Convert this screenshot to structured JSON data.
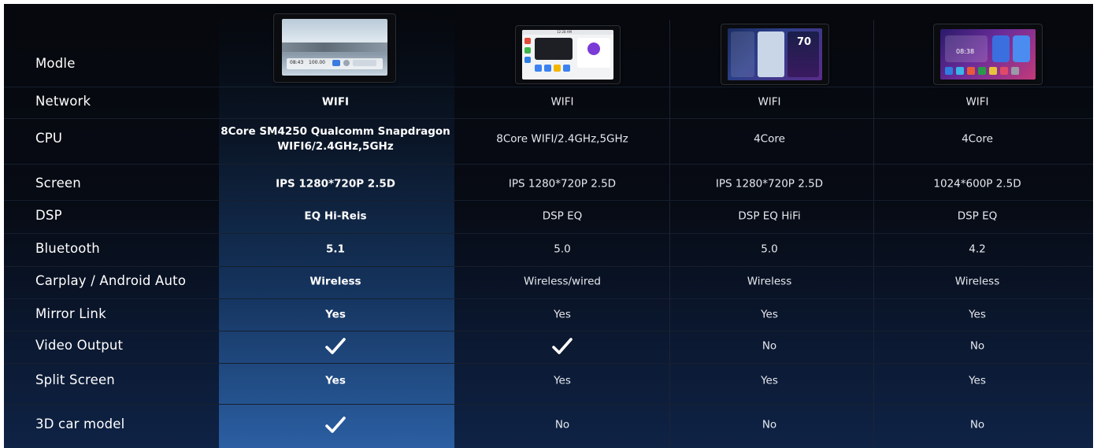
{
  "rows": [
    {
      "label": "Modle",
      "values": [
        "",
        "",
        "",
        ""
      ]
    },
    {
      "label": "Network",
      "values": [
        "WIFI",
        "WIFI",
        "WIFI",
        "WIFI"
      ]
    },
    {
      "label": "CPU",
      "values": [
        "8Core SM4250 Qualcomm Snapdragon\nWIFI6/2.4GHz,5GHz",
        "8Core WIFI/2.4GHz,5GHz",
        "4Core",
        "4Core"
      ]
    },
    {
      "label": "Screen",
      "values": [
        "IPS 1280*720P 2.5D",
        "IPS 1280*720P 2.5D",
        "IPS 1280*720P 2.5D",
        "1024*600P 2.5D"
      ]
    },
    {
      "label": "DSP",
      "values": [
        "EQ Hi-Reis",
        "DSP EQ",
        "DSP EQ HiFi",
        "DSP EQ"
      ]
    },
    {
      "label": "Bluetooth",
      "values": [
        "5.1",
        "5.0",
        "5.0",
        "4.2"
      ]
    },
    {
      "label": "Carplay / Android Auto",
      "values": [
        "Wireless",
        "Wireless/wired",
        "Wireless",
        "Wireless"
      ]
    },
    {
      "label": "Mirror Link",
      "values": [
        "Yes",
        "Yes",
        "Yes",
        "Yes"
      ]
    },
    {
      "label": "Video Output",
      "values": [
        "check",
        "check",
        "No",
        "No"
      ]
    },
    {
      "label": "Split Screen",
      "values": [
        "Yes",
        "Yes",
        "Yes",
        "Yes"
      ]
    },
    {
      "label": "3D car model",
      "values": [
        "check",
        "No",
        "No",
        "No"
      ]
    }
  ],
  "devices": [
    {
      "screen_text": [
        "08:43",
        "100.00"
      ]
    },
    {
      "screen_text": [
        "12:28 AM"
      ]
    },
    {
      "screen_text": [
        "70"
      ]
    },
    {
      "screen_text": [
        "08:38"
      ]
    }
  ],
  "colors": {
    "background_top": "#06080d",
    "background_bottom": "#0f2346",
    "highlight_bottom": "#2b5fa3",
    "text": "#ffffff"
  },
  "icons": {
    "check": "checkmark-icon"
  }
}
